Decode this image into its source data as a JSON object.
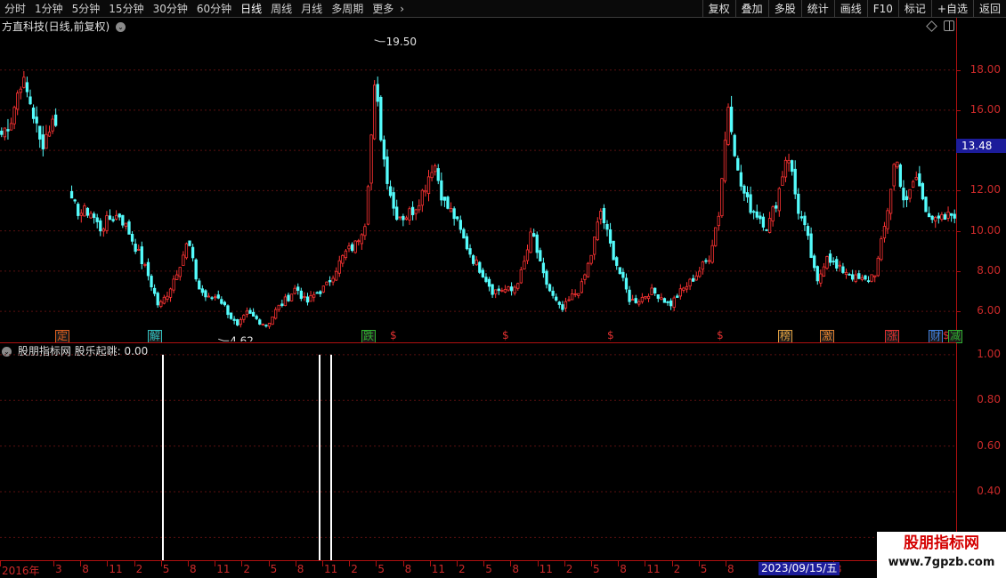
{
  "toolbar": {
    "periods": [
      "分时",
      "1分钟",
      "5分钟",
      "15分钟",
      "30分钟",
      "60分钟",
      "日线",
      "周线",
      "月线",
      "多周期",
      "更多"
    ],
    "active_period": "日线",
    "actions": [
      "复权",
      "叠加",
      "多股",
      "统计",
      "画线",
      "F10",
      "标记",
      "+自选",
      "返回"
    ]
  },
  "main_chart": {
    "title": "方直科技(日线,前复权)",
    "current_price_tag": "13.48",
    "high_label": "19.50",
    "low_label": "4.62",
    "y_tick_labels": [
      "18.00",
      "16.00",
      "14.00",
      "12.00",
      "10.00",
      "8.00",
      "6.00"
    ],
    "event_tags": [
      {
        "text": "定",
        "color": "#e06020"
      },
      {
        "text": "解",
        "color": "#30c0c0"
      },
      {
        "text": "跌",
        "color": "#30b030"
      },
      {
        "text": "$",
        "color": "#e03030"
      },
      {
        "text": "$",
        "color": "#e03030"
      },
      {
        "text": "$",
        "color": "#e03030"
      },
      {
        "text": "$",
        "color": "#e03030"
      },
      {
        "text": "榜",
        "color": "#e0a040"
      },
      {
        "text": "激",
        "color": "#e08030"
      },
      {
        "text": "涨",
        "color": "#e03030"
      },
      {
        "text": "财",
        "color": "#4080e0"
      },
      {
        "text": "$",
        "color": "#e03030"
      },
      {
        "text": "减",
        "color": "#30b030"
      }
    ]
  },
  "indicator_panel": {
    "title": "股朋指标网 股乐起跳: 0.00",
    "y_tick_labels": [
      "1.00",
      "0.80",
      "0.60",
      "0.40",
      "0.20"
    ]
  },
  "date_axis": {
    "labels": [
      "2016年",
      "3",
      "8",
      "11",
      "2",
      "5",
      "8",
      "11",
      "2",
      "5",
      "8",
      "11",
      "2",
      "5",
      "8",
      "11",
      "2",
      "5",
      "8",
      "11",
      "2",
      "5",
      "8",
      "11",
      "2",
      "5",
      "8",
      "11",
      "2",
      "5",
      "8"
    ],
    "cursor_date": "2023/09/15/五"
  },
  "watermark": {
    "title": "股朋指标网",
    "url": "www.7gpzb.com"
  },
  "colors": {
    "up": "#ff3333",
    "down": "#54fcfc",
    "axis": "#cc2a2a",
    "signal": "#ffffff"
  },
  "chart_data": [
    {
      "type": "candlestick",
      "title": "方直科技(日线,前复权)",
      "ylim": [
        4.5,
        19.8
      ],
      "y_ticks": [
        6,
        8,
        10,
        12,
        14,
        16,
        18
      ],
      "annotations": [
        {
          "label": "19.50",
          "value": 19.5
        },
        {
          "label": "4.62",
          "value": 4.62
        }
      ],
      "current_price": 13.48,
      "close_path": [
        14.8,
        15.6,
        17.6,
        16.3,
        14.2,
        15.3,
        15.8,
        11.4,
        10.9,
        11.0,
        10.1,
        10.6,
        10.8,
        9.9,
        8.8,
        7.7,
        6.2,
        7.0,
        8.2,
        9.5,
        7.2,
        6.6,
        6.8,
        6.0,
        5.2,
        5.9,
        5.6,
        5.3,
        6.1,
        6.6,
        7.2,
        6.4,
        6.9,
        7.2,
        8.1,
        8.9,
        9.3,
        10.5,
        17.2,
        13.3,
        10.9,
        10.7,
        11.1,
        12.1,
        13.5,
        11.4,
        10.8,
        9.6,
        8.6,
        7.9,
        7.0,
        7.1,
        7.0,
        8.0,
        10.0,
        7.9,
        6.8,
        6.0,
        6.7,
        7.2,
        8.8,
        11.0,
        9.2,
        7.8,
        6.5,
        6.6,
        7.0,
        6.8,
        6.3,
        6.9,
        7.4,
        8.0,
        8.7,
        10.9,
        16.5,
        12.6,
        11.3,
        10.8,
        10.2,
        11.7,
        14.1,
        11.2,
        9.7,
        7.3,
        8.9,
        8.1,
        8.0,
        7.6,
        7.5,
        8.0,
        10.5,
        13.8,
        11.1,
        12.8,
        11.3,
        10.4,
        10.6,
        10.9
      ]
    },
    {
      "type": "bar",
      "title": "股乐起跳",
      "current_value": 0.0,
      "ylim": [
        0.1,
        1.05
      ],
      "y_ticks": [
        0.2,
        0.4,
        0.6,
        0.8,
        1.0
      ],
      "series": [
        {
          "x_date": "2017-05",
          "value": 1.0
        },
        {
          "x_date": "2019-10",
          "value": 1.0
        },
        {
          "x_date": "2019-11",
          "value": 1.0
        }
      ]
    }
  ]
}
